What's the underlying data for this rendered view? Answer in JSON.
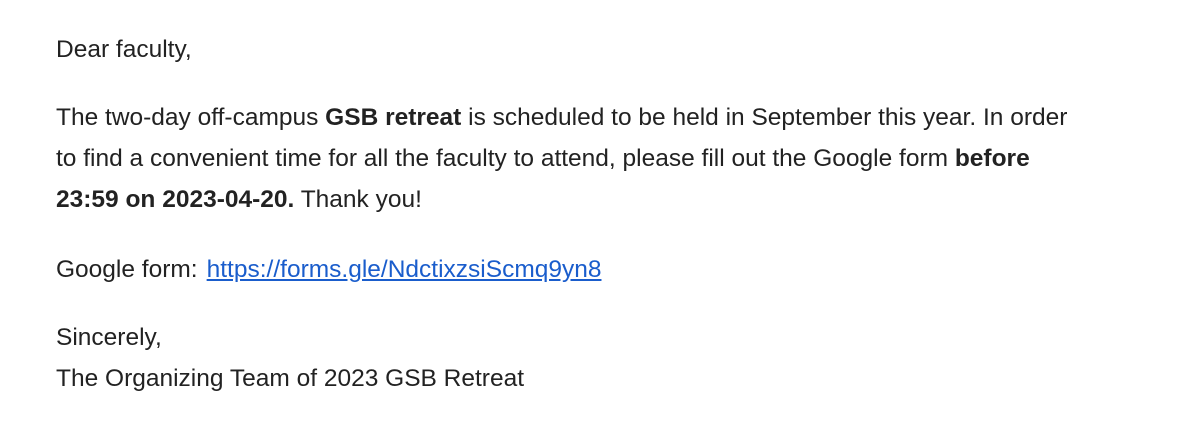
{
  "email": {
    "greeting": "Dear faculty,",
    "paragraph": {
      "seg1": "The two-day off-campus ",
      "bold1": "GSB retreat",
      "seg2": " is scheduled to be held in September this year. In order",
      "seg3": "to find a convenient time for all the faculty to attend, please fill out the Google form ",
      "bold2a": "before",
      "bold2b": "23:59 on 2023-04-20.",
      "seg4": " Thank you!"
    },
    "form_label": "Google form:",
    "form_url": "https://forms.gle/NdctixzsiScmq9yn8",
    "closing": "Sincerely,",
    "signature": "The Organizing Team of 2023 GSB Retreat"
  },
  "colors": {
    "text": "#222222",
    "link": "#1a5dcc"
  }
}
